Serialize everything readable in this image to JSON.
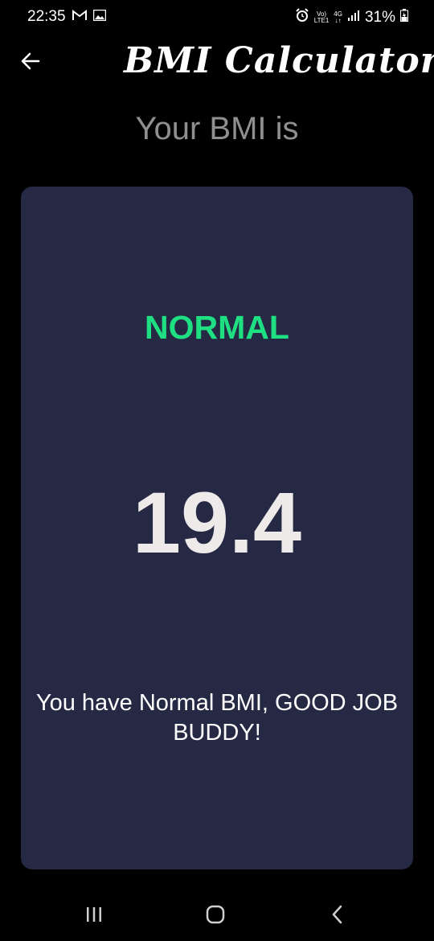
{
  "status_bar": {
    "time": "22:35",
    "left_icons": [
      "gmail-icon",
      "gallery-icon"
    ],
    "right_icons": [
      "alarm-icon",
      "volte-icon",
      "network-4g-icon",
      "signal-icon",
      "battery-charging-icon"
    ],
    "volte_line1": "Vo)",
    "volte_line2": "LTE1",
    "network_label": "4G",
    "battery_percent": "31%"
  },
  "app_bar": {
    "title": "BMI Calculator",
    "back_icon": "arrow-left-icon"
  },
  "headline": "Your BMI is",
  "result": {
    "category": "NORMAL",
    "value": "19.4",
    "message": "You have Normal BMI, GOOD JOB BUDDY!",
    "category_color": "#1ee083",
    "card_color": "#262944"
  },
  "nav_bar": {
    "recents_icon": "recent-apps-icon",
    "home_icon": "home-icon",
    "back_icon": "back-chevron-icon"
  }
}
